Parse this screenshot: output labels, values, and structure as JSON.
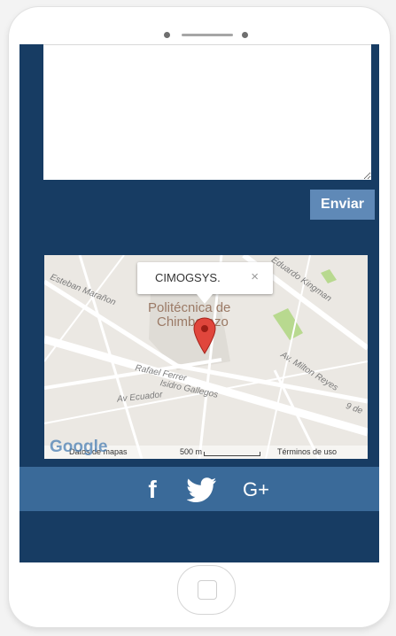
{
  "form": {
    "message_value": "",
    "send_label": "Enviar"
  },
  "map": {
    "popup_title": "CIMOGSYS.",
    "popup_close": "×",
    "place_line1": "Politécnica de",
    "place_line2": "Chimborazo",
    "streets": {
      "esteban": "Esteban Marañon",
      "eduardo": "Eduardo Kingman",
      "milton": "Av. Milton Reyes",
      "rafael": "Rafael Ferrer",
      "isidro": "Isidro Gallegos",
      "ecuador": "Av Ecuador",
      "de": "9 de"
    },
    "footer": {
      "logo": "Google",
      "data_label": "Datos de mapas",
      "scale_label": "500 m",
      "terms_label": "Términos de uso"
    }
  },
  "social": {
    "facebook": "f",
    "googleplus": "G+"
  },
  "colors": {
    "screen_bg": "#173c63",
    "social_bar": "#3a6a99",
    "button": "#5f89b7",
    "pin": "#e0463c"
  }
}
